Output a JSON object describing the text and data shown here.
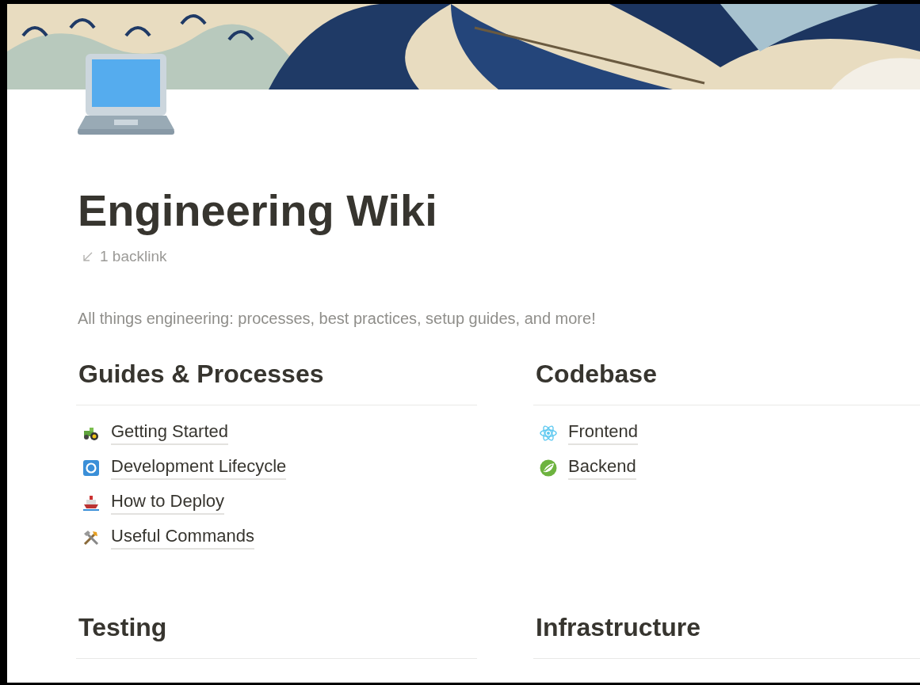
{
  "page": {
    "title": "Engineering Wiki",
    "backlinks": "1 backlink",
    "description": "All things engineering: processes, best practices, setup guides, and more!"
  },
  "sections": [
    {
      "heading": "Guides & Processes",
      "items": [
        {
          "label": "Getting Started",
          "kind": "tractor"
        },
        {
          "label": "Development Lifecycle",
          "kind": "cycle"
        },
        {
          "label": "How to Deploy",
          "kind": "ship"
        },
        {
          "label": "Useful Commands",
          "kind": "tools"
        }
      ]
    },
    {
      "heading": "Codebase",
      "items": [
        {
          "label": "Frontend",
          "kind": "atom"
        },
        {
          "label": "Backend",
          "kind": "leaf"
        }
      ]
    },
    {
      "heading": "Testing"
    },
    {
      "heading": "Infrastructure"
    }
  ]
}
